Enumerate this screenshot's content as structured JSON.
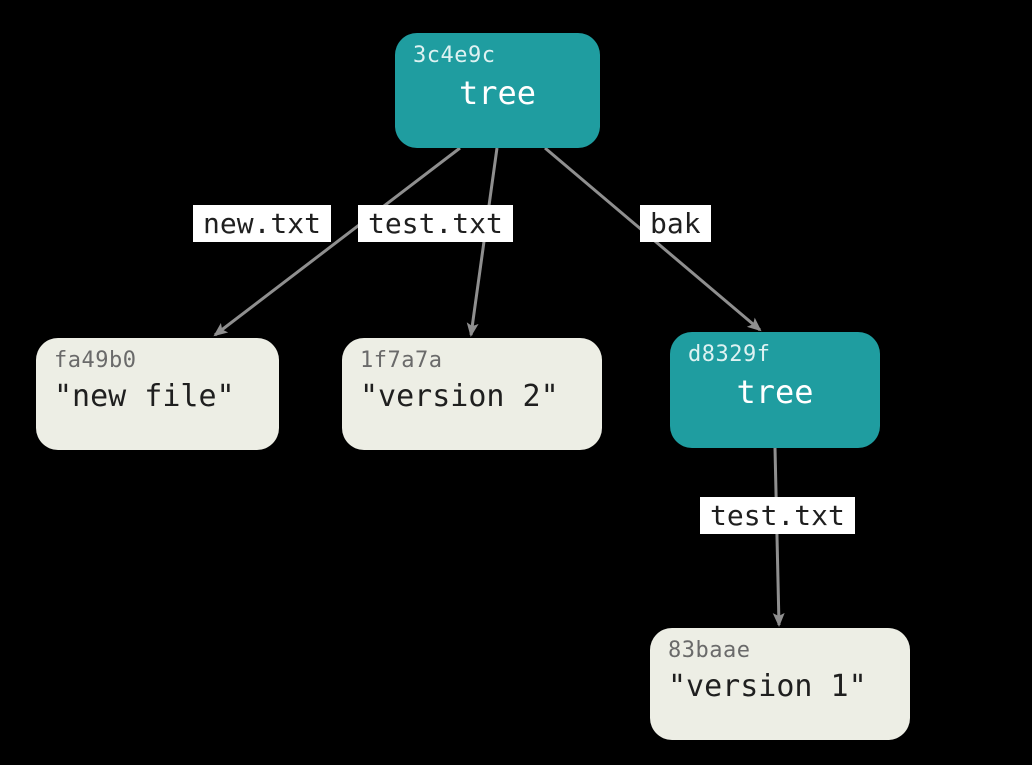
{
  "nodes": {
    "root_tree": {
      "hash": "3c4e9c",
      "type": "tree"
    },
    "blob_new": {
      "hash": "fa49b0",
      "content": "\"new file\""
    },
    "blob_v2": {
      "hash": "1f7a7a",
      "content": "\"version 2\""
    },
    "sub_tree": {
      "hash": "d8329f",
      "type": "tree"
    },
    "blob_v1": {
      "hash": "83baae",
      "content": "\"version 1\""
    }
  },
  "edges": {
    "root_to_new": {
      "label": "new.txt"
    },
    "root_to_v2": {
      "label": "test.txt"
    },
    "root_to_bak": {
      "label": "bak"
    },
    "bak_to_v1": {
      "label": "test.txt"
    }
  },
  "colors": {
    "tree_fill": "#1f9da0",
    "blob_fill": "#edeee5",
    "arrow": "#8f8f8f"
  }
}
